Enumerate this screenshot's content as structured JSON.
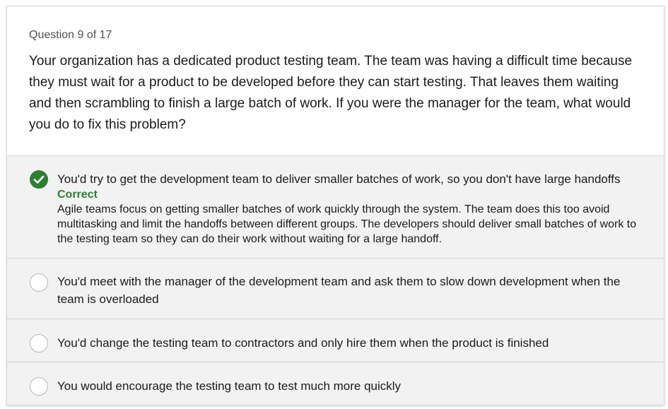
{
  "question": {
    "number_label": "Question 9 of 17",
    "text": "Your organization has a dedicated product testing team. The team was having a difficult time because they must wait for a product to be developed before they can start testing. That leaves them waiting and then scrambling to finish a large batch of work. If you were the manager for the team, what would you do to fix this problem?"
  },
  "options": [
    {
      "text": "You'd try to get the development team to deliver smaller batches of work, so you don't have large handoffs",
      "status_label": "Correct",
      "explanation": "Agile teams focus on getting smaller batches of work quickly through the system. The team does this too avoid multitasking and limit the handoffs between different groups. The developers should deliver small batches of work to the testing team so they can do their work without waiting for a large handoff.",
      "selected": true,
      "icon": "checkmark-circle-icon"
    },
    {
      "text": "You'd meet with the manager of the development team and ask them to slow down development when the team is overloaded",
      "selected": false,
      "icon": "radio-empty-icon"
    },
    {
      "text": "You'd change the testing team to contractors and only hire them when the product is finished",
      "selected": false,
      "icon": "radio-empty-icon"
    },
    {
      "text": "You would encourage the testing team to test much more quickly",
      "selected": false,
      "icon": "radio-empty-icon"
    }
  ],
  "colors": {
    "correct_green": "#2e7d32",
    "option_background": "#f2f2f2",
    "border": "#d7d7d7"
  }
}
